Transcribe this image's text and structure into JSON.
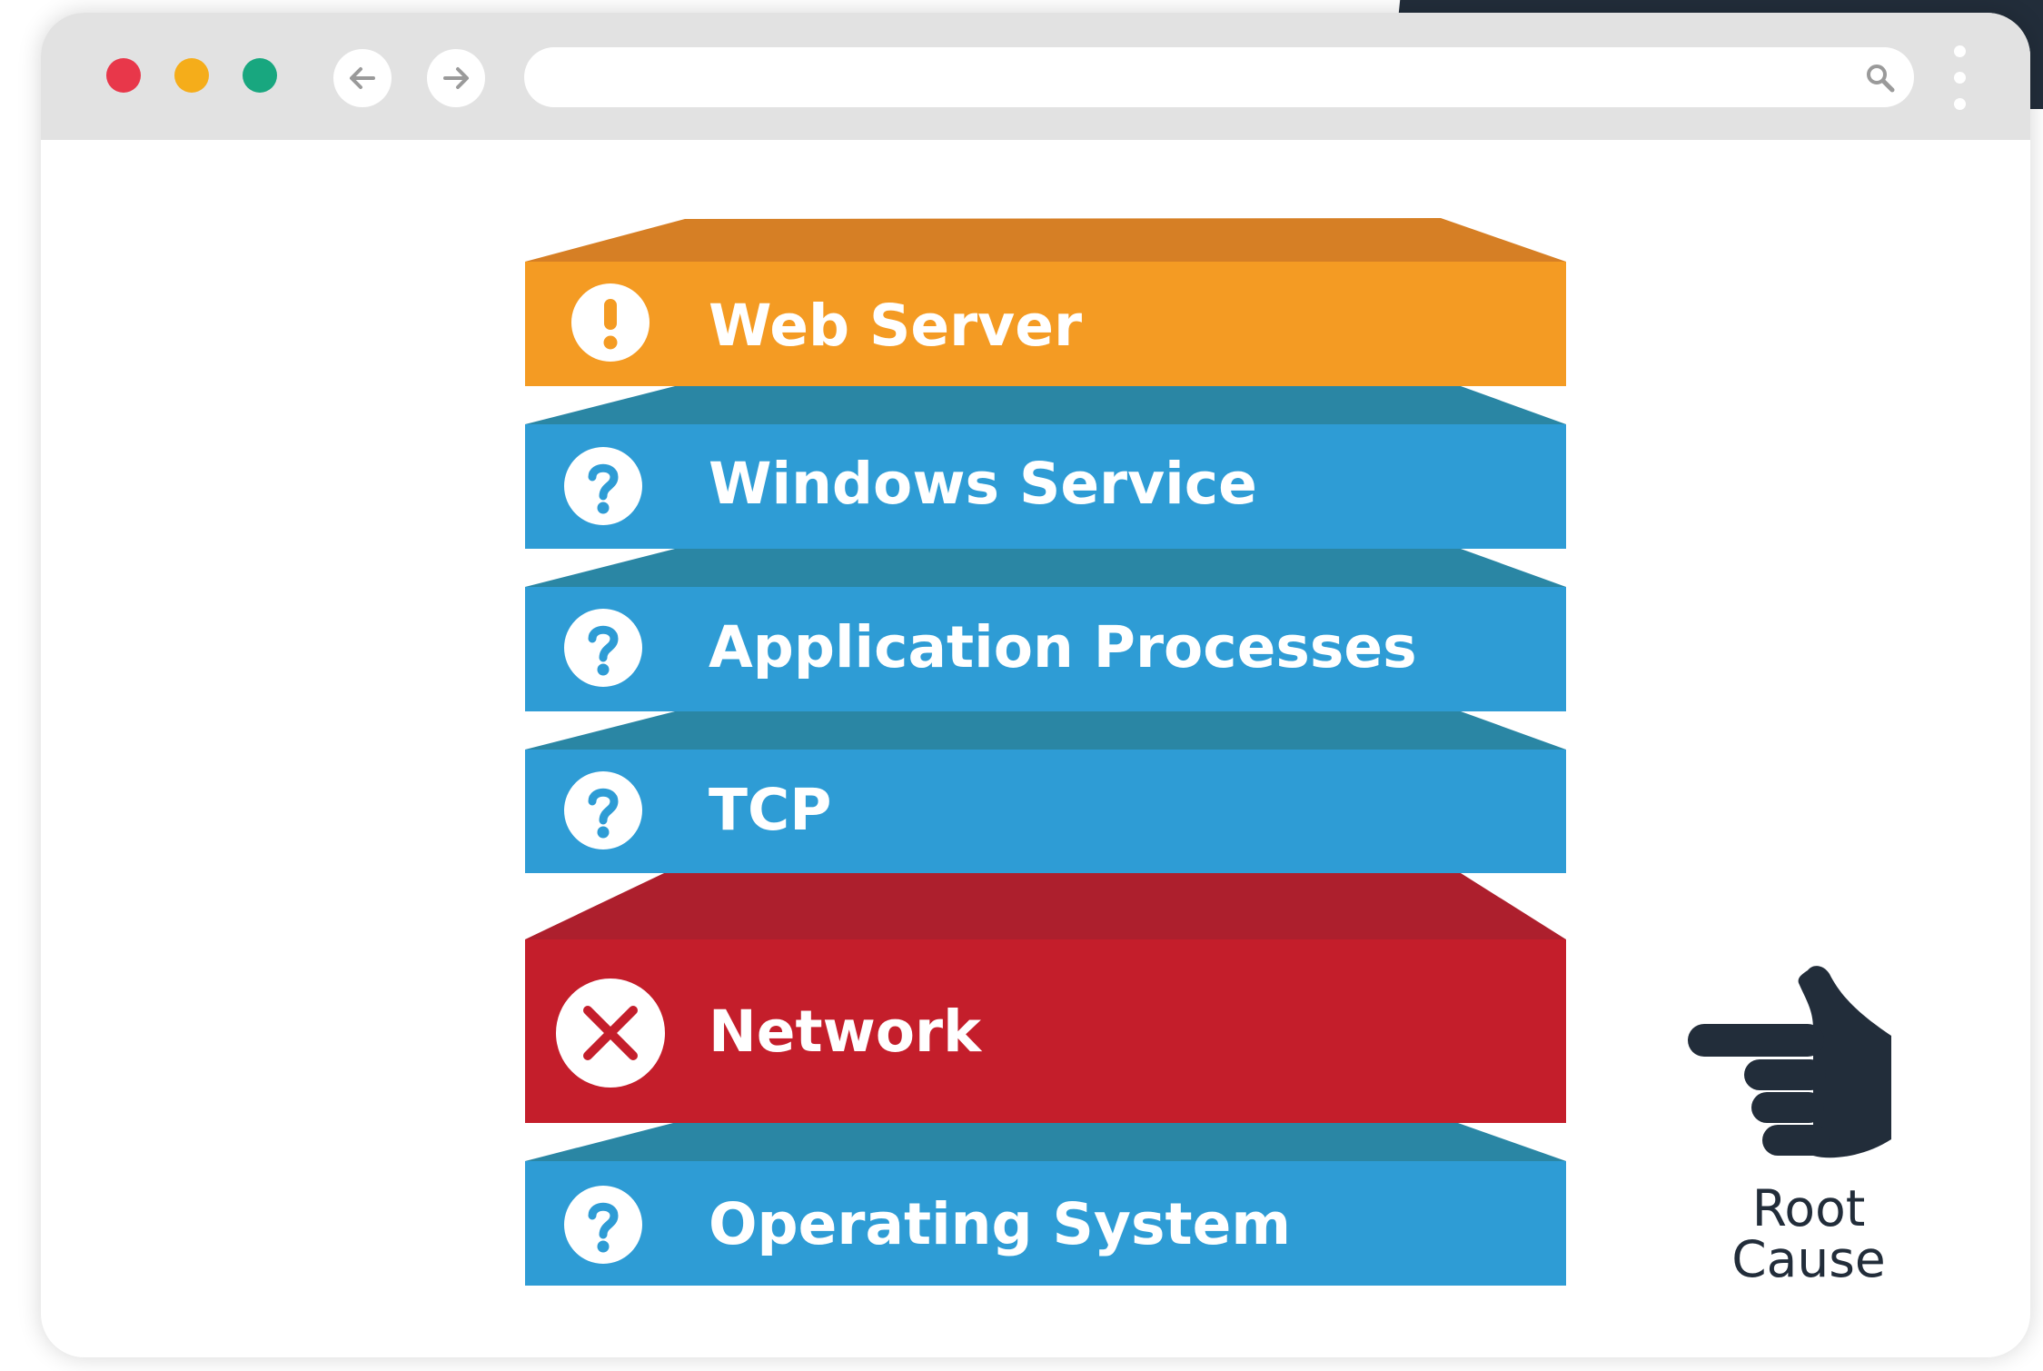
{
  "colors": {
    "warning": "#f49b23",
    "warning_top": "#d67f25",
    "unknown": "#2e9cd5",
    "unknown_top": "#2a86a4",
    "error": "#c41e2b",
    "error_top": "#ad1f2d",
    "dark": "#222d3a"
  },
  "browser": {
    "controls": [
      "close-dot",
      "minimize-dot",
      "maximize-dot"
    ],
    "back_icon": "arrow-left-icon",
    "forward_icon": "arrow-right-icon",
    "address_value": "",
    "search_icon": "search-icon",
    "menu_icon": "more-vertical-icon"
  },
  "layers": [
    {
      "label": "Web Server",
      "status": "warning",
      "icon": "exclamation-icon"
    },
    {
      "label": "Windows Service",
      "status": "unknown",
      "icon": "question-icon"
    },
    {
      "label": "Application Processes",
      "status": "unknown",
      "icon": "question-icon"
    },
    {
      "label": "TCP",
      "status": "unknown",
      "icon": "question-icon"
    },
    {
      "label": "Network",
      "status": "error",
      "icon": "x-icon"
    },
    {
      "label": "Operating System",
      "status": "unknown",
      "icon": "question-icon"
    }
  ],
  "root_cause": {
    "line1": "Root",
    "line2": "Cause",
    "icon": "pointing-hand-icon"
  }
}
